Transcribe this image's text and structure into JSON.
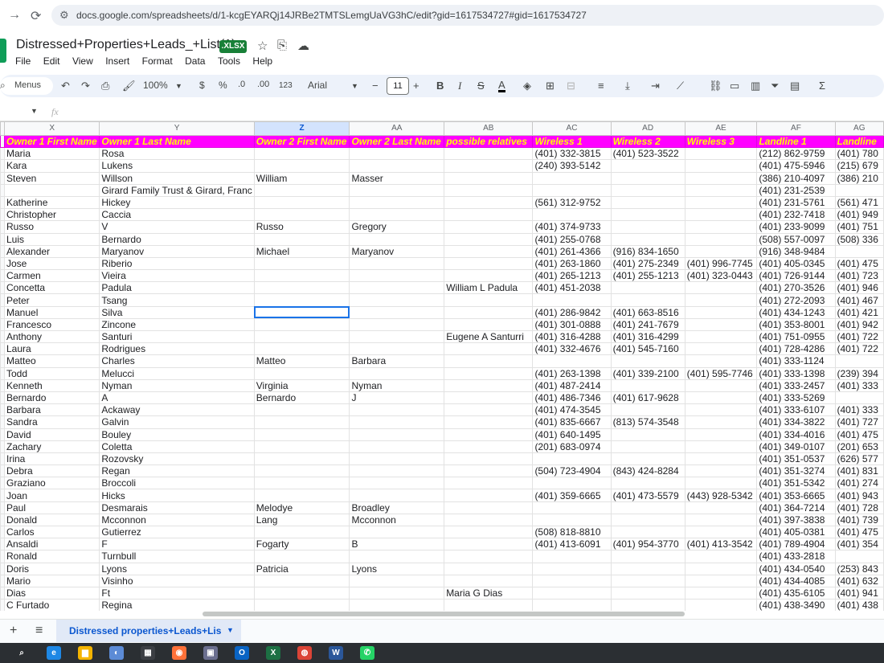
{
  "browser": {
    "url": "docs.google.com/spreadsheets/d/1-kcgEYARQj14JRBe2TMTSLemgUaVG3hC/edit?gid=1617534727#gid=1617534727"
  },
  "doc": {
    "title": "Distressed+Properties+Leads_+List(1)",
    "badge": ".XLSX"
  },
  "menu": [
    "File",
    "Edit",
    "View",
    "Insert",
    "Format",
    "Data",
    "Tools",
    "Help"
  ],
  "toolbar": {
    "menus_label": "Menus",
    "zoom": "100%",
    "currency": "$",
    "percent": "%",
    "dec_decrease": ".0",
    "dec_increase": ".00",
    "number_format": "123",
    "font": "Arial",
    "font_size": "11"
  },
  "formula": {
    "fx": "fx"
  },
  "grid": {
    "columns": [
      "X",
      "Y",
      "Z",
      "AA",
      "AB",
      "AC",
      "AD",
      "AE",
      "AF",
      "AG"
    ],
    "selected_column": "Z",
    "headers": [
      "Owner 1 First Name",
      "Owner 1 Last Name",
      "Owner 2 First Name",
      "Owner 2 Last Name",
      "possible relatives",
      "Wireless 1",
      "Wireless 2",
      "Wireless 3",
      "Landline 1",
      "Landline"
    ],
    "rows": [
      [
        "Maria",
        "Rosa",
        "",
        "",
        "",
        "(401) 332-3815",
        "(401) 523-3522",
        "",
        "(212) 862-9759",
        "(401) 780"
      ],
      [
        "Kara",
        "Lukens",
        "",
        "",
        "",
        "(240) 393-5142",
        "",
        "",
        "(401) 475-5946",
        "(215) 679"
      ],
      [
        "Steven",
        "Willson",
        "William",
        "Masser",
        "",
        "",
        "",
        "",
        "(386) 210-4097",
        "(386) 210"
      ],
      [
        "",
        "Girard Family Trust & Girard, Franc",
        "",
        "",
        "",
        "",
        "",
        "",
        "(401) 231-2539",
        ""
      ],
      [
        "Katherine",
        "Hickey",
        "",
        "",
        "",
        "(561) 312-9752",
        "",
        "",
        "(401) 231-5761",
        "(561) 471"
      ],
      [
        "Christopher",
        "Caccia",
        "",
        "",
        "",
        "",
        "",
        "",
        "(401) 232-7418",
        "(401) 949"
      ],
      [
        "Russo",
        "V",
        "Russo",
        "Gregory",
        "",
        "(401) 374-9733",
        "",
        "",
        "(401) 233-9099",
        "(401) 751"
      ],
      [
        "Luis",
        "Bernardo",
        "",
        "",
        "",
        "(401) 255-0768",
        "",
        "",
        "(508) 557-0097",
        "(508) 336"
      ],
      [
        "Alexander",
        "Maryanov",
        "Michael",
        "Maryanov",
        "",
        "(401) 261-4366",
        "(916) 834-1650",
        "",
        "(916) 348-9484",
        ""
      ],
      [
        "Jose",
        "Riberio",
        "",
        "",
        "",
        "(401) 263-1860",
        "(401) 275-2349",
        "(401) 996-7745",
        "(401) 405-0345",
        "(401) 475"
      ],
      [
        "Carmen",
        "Vieira",
        "",
        "",
        "",
        "(401) 265-1213",
        "(401) 255-1213",
        "(401) 323-0443",
        "(401) 726-9144",
        "(401) 723"
      ],
      [
        "Concetta",
        "Padula",
        "",
        "",
        "William L Padula",
        "(401) 451-2038",
        "",
        "",
        "(401) 270-3526",
        "(401) 946"
      ],
      [
        "Peter",
        "Tsang",
        "",
        "",
        "",
        "",
        "",
        "",
        "(401) 272-2093",
        "(401) 467"
      ],
      [
        "Manuel",
        "Silva",
        "",
        "",
        "",
        "(401) 286-9842",
        "(401) 663-8516",
        "",
        "(401) 434-1243",
        "(401) 421"
      ],
      [
        "Francesco",
        "Zincone",
        "",
        "",
        "",
        "(401) 301-0888",
        "(401) 241-7679",
        "",
        "(401) 353-8001",
        "(401) 942"
      ],
      [
        "Anthony",
        "Santuri",
        "",
        "",
        "Eugene A Santurri",
        "(401) 316-4288",
        "(401) 316-4299",
        "",
        "(401) 751-0955",
        "(401) 722"
      ],
      [
        "Laura",
        "Rodrigues",
        "",
        "",
        "",
        "(401) 332-4676",
        "(401) 545-7160",
        "",
        "(401) 728-4286",
        "(401) 722"
      ],
      [
        "Matteo",
        "Charles",
        "Matteo",
        "Barbara",
        "",
        "",
        "",
        "",
        "(401) 333-1124",
        ""
      ],
      [
        "Todd",
        "Melucci",
        "",
        "",
        "",
        "(401) 263-1398",
        "(401) 339-2100",
        "(401) 595-7746",
        "(401) 333-1398",
        "(239) 394"
      ],
      [
        "Kenneth",
        "Nyman",
        "Virginia",
        "Nyman",
        "",
        "(401) 487-2414",
        "",
        "",
        "(401) 333-2457",
        "(401) 333"
      ],
      [
        "Bernardo",
        "A",
        "Bernardo",
        "J",
        "",
        "(401) 486-7346",
        "(401) 617-9628",
        "",
        "(401) 333-5269",
        ""
      ],
      [
        "Barbara",
        "Ackaway",
        "",
        "",
        "",
        "(401) 474-3545",
        "",
        "",
        "(401) 333-6107",
        "(401) 333"
      ],
      [
        "Sandra",
        "Galvin",
        "",
        "",
        "",
        "(401) 835-6667",
        "(813) 574-3548",
        "",
        "(401) 334-3822",
        "(401) 727"
      ],
      [
        "David",
        "Bouley",
        "",
        "",
        "",
        "(401) 640-1495",
        "",
        "",
        "(401) 334-4016",
        "(401) 475"
      ],
      [
        "Zachary",
        "Coletta",
        "",
        "",
        "",
        "(201) 683-0974",
        "",
        "",
        "(401) 349-0107",
        "(201) 653"
      ],
      [
        "Irina",
        "Rozovsky",
        "",
        "",
        "",
        "",
        "",
        "",
        "(401) 351-0537",
        "(626) 577"
      ],
      [
        "Debra",
        "Regan",
        "",
        "",
        "",
        "(504) 723-4904",
        "(843) 424-8284",
        "",
        "(401) 351-3274",
        "(401) 831"
      ],
      [
        "Graziano",
        "Broccoli",
        "",
        "",
        "",
        "",
        "",
        "",
        "(401) 351-5342",
        "(401) 274"
      ],
      [
        "Joan",
        "Hicks",
        "",
        "",
        "",
        "(401) 359-6665",
        "(401) 473-5579",
        "(443) 928-5342",
        "(401) 353-6665",
        "(401) 943"
      ],
      [
        "Paul",
        "Desmarais",
        "Melodye",
        "Broadley",
        "",
        "",
        "",
        "",
        "(401) 364-7214",
        "(401) 728"
      ],
      [
        "Donald",
        "Mcconnon",
        "Lang",
        "Mcconnon",
        "",
        "",
        "",
        "",
        "(401) 397-3838",
        "(401) 739"
      ],
      [
        "Carlos",
        "Gutierrez",
        "",
        "",
        "",
        "(508) 818-8810",
        "",
        "",
        "(401) 405-0381",
        "(401) 475"
      ],
      [
        "Ansaldi",
        "F",
        "Fogarty",
        "B",
        "",
        "(401) 413-6091",
        "(401) 954-3770",
        "(401) 413-3542",
        "(401) 789-4904",
        "(401) 354"
      ],
      [
        "Ronald",
        "Turnbull",
        "",
        "",
        "",
        "",
        "",
        "",
        "(401) 433-2818",
        ""
      ],
      [
        "Doris",
        "Lyons",
        "Patricia",
        "Lyons",
        "",
        "",
        "",
        "",
        "(401) 434-0540",
        "(253) 843"
      ],
      [
        "Mario",
        "Visinho",
        "",
        "",
        "",
        "",
        "",
        "",
        "(401) 434-4085",
        "(401) 632"
      ],
      [
        "Dias",
        "Ft",
        "",
        "",
        "Maria G Dias",
        "",
        "",
        "",
        "(401) 435-6105",
        "(401) 941"
      ],
      [
        "C Furtado",
        "Regina",
        "",
        "",
        "",
        "",
        "",
        "",
        "(401) 438-3490",
        "(401) 438"
      ]
    ]
  },
  "sheet_tabs": {
    "add": "+",
    "all": "≡",
    "active_tab": "Distressed properties+Leads+Lis"
  },
  "taskbar": {
    "apps": [
      {
        "name": "search",
        "glyph": "⌕",
        "color": "#2b2f33"
      },
      {
        "name": "edge",
        "glyph": "e",
        "color": "#1e88e5"
      },
      {
        "name": "explorer",
        "glyph": "▆",
        "color": "#f4b400"
      },
      {
        "name": "settings",
        "glyph": "◐",
        "color": "#5c8bd6"
      },
      {
        "name": "figma",
        "glyph": "▦",
        "color": "#3c3f44"
      },
      {
        "name": "firefox",
        "glyph": "◉",
        "color": "#ff7139"
      },
      {
        "name": "store",
        "glyph": "▣",
        "color": "#6b6f8f"
      },
      {
        "name": "outlook",
        "glyph": "O",
        "color": "#0a64c4"
      },
      {
        "name": "excel",
        "glyph": "X",
        "color": "#1d7044"
      },
      {
        "name": "chrome",
        "glyph": "◍",
        "color": "#db4437"
      },
      {
        "name": "word",
        "glyph": "W",
        "color": "#2b579a"
      },
      {
        "name": "whatsapp",
        "glyph": "✆",
        "color": "#25d366"
      }
    ]
  }
}
